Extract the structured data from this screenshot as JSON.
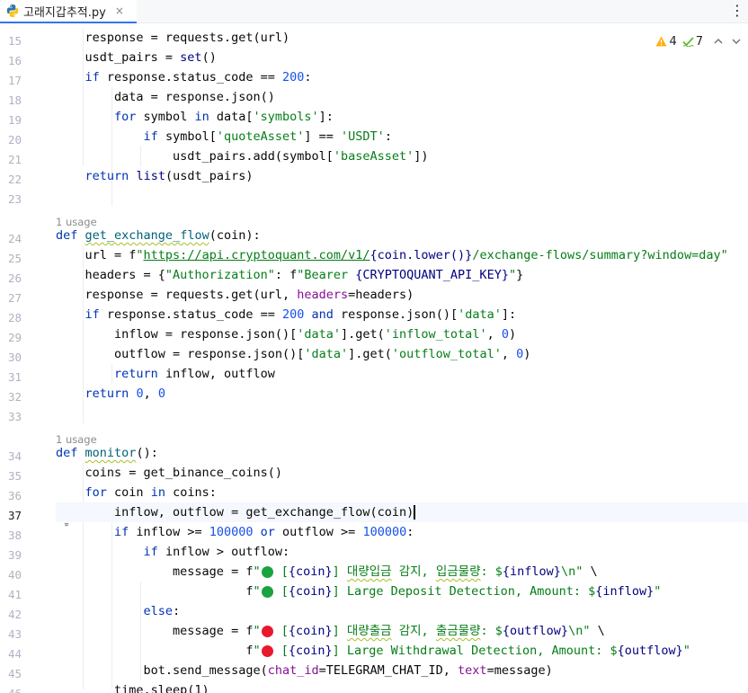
{
  "tab": {
    "title": "고래지갑추적.py",
    "close": "×",
    "more": "⋮"
  },
  "inspection": {
    "warnings": "4",
    "weak_warnings": "7"
  },
  "inlays": [
    "1 usage",
    "1 usage"
  ],
  "line_numbers": [
    "15",
    "16",
    "17",
    "18",
    "19",
    "20",
    "21",
    "22",
    "23",
    "24",
    "25",
    "26",
    "27",
    "28",
    "29",
    "30",
    "31",
    "32",
    "33",
    "34",
    "35",
    "36",
    "37",
    "38",
    "39",
    "40",
    "41",
    "42",
    "43",
    "44",
    "45",
    "46"
  ],
  "colors": {
    "keyword": "#0033b3",
    "string": "#067d17",
    "number": "#1750eb",
    "kwarg": "#871094",
    "function": "#00627a",
    "green_dot": "#1aa33e",
    "red_dot": "#e8192c",
    "accent": "#3574f0"
  },
  "code": {
    "l15": {
      "a": "    response = requests.get(url)"
    },
    "l16": {
      "a": "    usdt_pairs = ",
      "b": "set",
      "c": "()"
    },
    "l17": {
      "a": "if",
      "b": " response.status_code == ",
      "c": "200",
      "d": ":"
    },
    "l18": {
      "a": "        data = response.json()"
    },
    "l19": {
      "a": "for",
      "b": " symbol ",
      "c": "in",
      "d": " data[",
      "e": "'symbols'",
      "f": "]:"
    },
    "l20": {
      "a": "if",
      "b": " symbol[",
      "c": "'quoteAsset'",
      "d": "] == ",
      "e": "'USDT'",
      "f": ":"
    },
    "l21": {
      "a": "                usdt_pairs.add(symbol[",
      "b": "'baseAsset'",
      "c": "])"
    },
    "l22": {
      "a": "return",
      "b": " ",
      "c": "list",
      "d": "(usdt_pairs)"
    },
    "l24": {
      "a": "def",
      "b": " ",
      "c": "get_exchange_flow",
      "d": "(coin):"
    },
    "l25": {
      "a": "    url = f\"",
      "b": "https://api.cryptoquant.com/v1/",
      "c": "{coin.lower()}",
      "d": "/exchange-flows/summary?window=day\""
    },
    "l26": {
      "a": "    headers = {",
      "b": "\"Authorization\"",
      "c": ": f\"Bearer ",
      "d": "{CRYPTOQUANT_API_KEY}",
      "e": "\"",
      "f": "}"
    },
    "l27": {
      "a": "    response = requests.get(url, ",
      "b": "headers",
      "c": "=headers)"
    },
    "l28": {
      "a": "if",
      "b": " response.status_code == ",
      "c": "200",
      "d": " ",
      "e": "and",
      "f": " response.json()[",
      "g": "'data'",
      "h": "]:"
    },
    "l29": {
      "a": "        inflow = response.json()[",
      "b": "'data'",
      "c": "].get(",
      "d": "'inflow_total'",
      "e": ", ",
      "f": "0",
      "g": ")"
    },
    "l30": {
      "a": "        outflow = response.json()[",
      "b": "'data'",
      "c": "].get(",
      "d": "'outflow_total'",
      "e": ", ",
      "f": "0",
      "g": ")"
    },
    "l31": {
      "a": "return",
      "b": " inflow, outflow"
    },
    "l32": {
      "a": "return",
      "b": " ",
      "c": "0",
      "d": ", ",
      "e": "0"
    },
    "l34": {
      "a": "def",
      "b": " ",
      "c": "monitor",
      "d": "():"
    },
    "l35": {
      "a": "    coins = get_binance_coins()"
    },
    "l36": {
      "a": "for",
      "b": " coin ",
      "c": "in",
      "d": " coins:"
    },
    "l37": {
      "a": "        inflow, outflow = get_exchange_flow(coin)"
    },
    "l38": {
      "a": "if",
      "b": " inflow >= ",
      "c": "100000",
      "d": " ",
      "e": "or",
      "f": " outflow >= ",
      "g": "100000",
      "h": ":"
    },
    "l39": {
      "a": "if",
      "b": " inflow > outflow:"
    },
    "l40": {
      "a": "                message = f\"",
      "b": " [",
      "c": "{coin}",
      "d": "] ",
      "e": "대량입금",
      "f": " 감지, ",
      "g": "입금물량",
      "h": ": $",
      "i": "{inflow}",
      "j": "\\n\"",
      "k": " \\"
    },
    "l41": {
      "a": "                          f\"",
      "b": " [",
      "c": "{coin}",
      "d": "] Large Deposit Detection, Amount: $",
      "e": "{inflow}",
      "f": "\""
    },
    "l42": {
      "a": "else",
      "b": ":"
    },
    "l43": {
      "a": "                message = f\"",
      "b": " [",
      "c": "{coin}",
      "d": "] ",
      "e": "대량출금",
      "f": " 감지, ",
      "g": "출금물량",
      "h": ": $",
      "i": "{outflow}",
      "j": "\\n\"",
      "k": " \\"
    },
    "l44": {
      "a": "                          f\"",
      "b": " [",
      "c": "{coin}",
      "d": "] Large Withdrawal Detection, Amount: $",
      "e": "{outflow}",
      "f": "\""
    },
    "l45": {
      "a": "            bot.send_message(",
      "b": "chat_id",
      "c": "=TELEGRAM_CHAT_ID, ",
      "d": "text",
      "e": "=message)"
    },
    "l46": {
      "a": "        time.sleep(1)"
    }
  }
}
